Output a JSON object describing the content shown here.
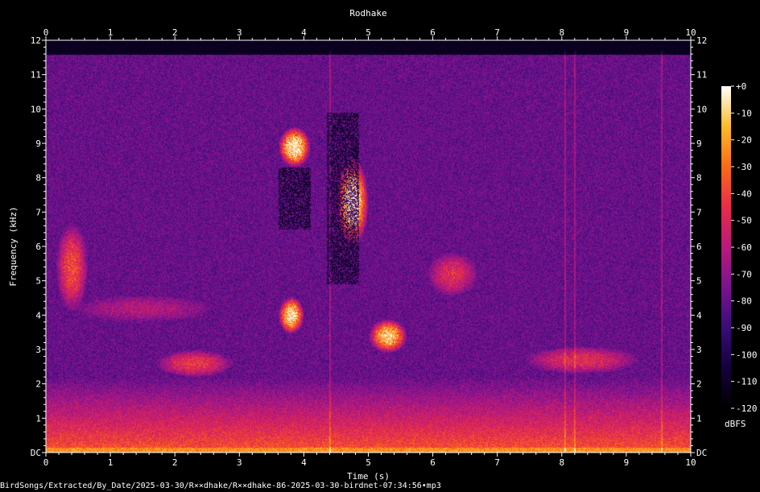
{
  "chart_data": {
    "type": "heatmap",
    "title": "Rodhake",
    "xlabel": "Time (s)",
    "ylabel": "Frequency (kHz)",
    "xlim": [
      0,
      10
    ],
    "ylim": [
      0,
      12
    ],
    "x_ticks": [
      "0",
      "1",
      "2",
      "3",
      "4",
      "5",
      "6",
      "7",
      "8",
      "9",
      "10"
    ],
    "y_ticks": [
      "DC",
      "1",
      "2",
      "3",
      "4",
      "5",
      "6",
      "7",
      "8",
      "9",
      "10",
      "11",
      "12"
    ],
    "colorbar": {
      "label": "dBFS",
      "range": [
        -120,
        0
      ],
      "ticks": [
        "+0",
        "-10",
        "-20",
        "-30",
        "-40",
        "-50",
        "-60",
        "-70",
        "-80",
        "-90",
        "-100",
        "-110",
        "-120"
      ],
      "colors": [
        "#000000",
        "#14003c",
        "#3a0c78",
        "#7a1390",
        "#b81a7c",
        "#e82c4a",
        "#fa6a18",
        "#fdbb2a",
        "#ffffff"
      ]
    },
    "hotspots": [
      {
        "t": 0.4,
        "f": 5.4,
        "dt": 0.5,
        "df": 2.6,
        "level": 0.45
      },
      {
        "t": 3.85,
        "f": 8.9,
        "dt": 0.5,
        "df": 1.2,
        "level": 0.85
      },
      {
        "t": 3.8,
        "f": 4.0,
        "dt": 0.4,
        "df": 1.1,
        "level": 0.8
      },
      {
        "t": 4.75,
        "f": 7.3,
        "dt": 0.5,
        "df": 2.6,
        "level": 0.85
      },
      {
        "t": 5.3,
        "f": 3.4,
        "dt": 0.6,
        "df": 1.0,
        "level": 0.75
      },
      {
        "t": 6.3,
        "f": 5.2,
        "dt": 0.8,
        "df": 1.3,
        "level": 0.35
      },
      {
        "t": 2.3,
        "f": 2.6,
        "dt": 1.2,
        "df": 0.8,
        "level": 0.4
      },
      {
        "t": 8.3,
        "f": 2.7,
        "dt": 1.8,
        "df": 0.8,
        "level": 0.35
      },
      {
        "t": 1.5,
        "f": 4.2,
        "dt": 2.2,
        "df": 0.8,
        "level": 0.2
      }
    ],
    "dark_regions": [
      {
        "t": 3.85,
        "f": 7.4,
        "dt": 0.5,
        "df": 1.8
      },
      {
        "t": 4.6,
        "f": 7.4,
        "dt": 0.5,
        "df": 5.0
      }
    ],
    "vertical_streaks": [
      4.4,
      8.05,
      8.2,
      9.55
    ]
  },
  "file": {
    "path": "BirdSongs/Extracted/By_Date/2025-03-30/R××dhake/R××dhake-86-2025-03-30-birdnet-07:34:56•mp3"
  }
}
